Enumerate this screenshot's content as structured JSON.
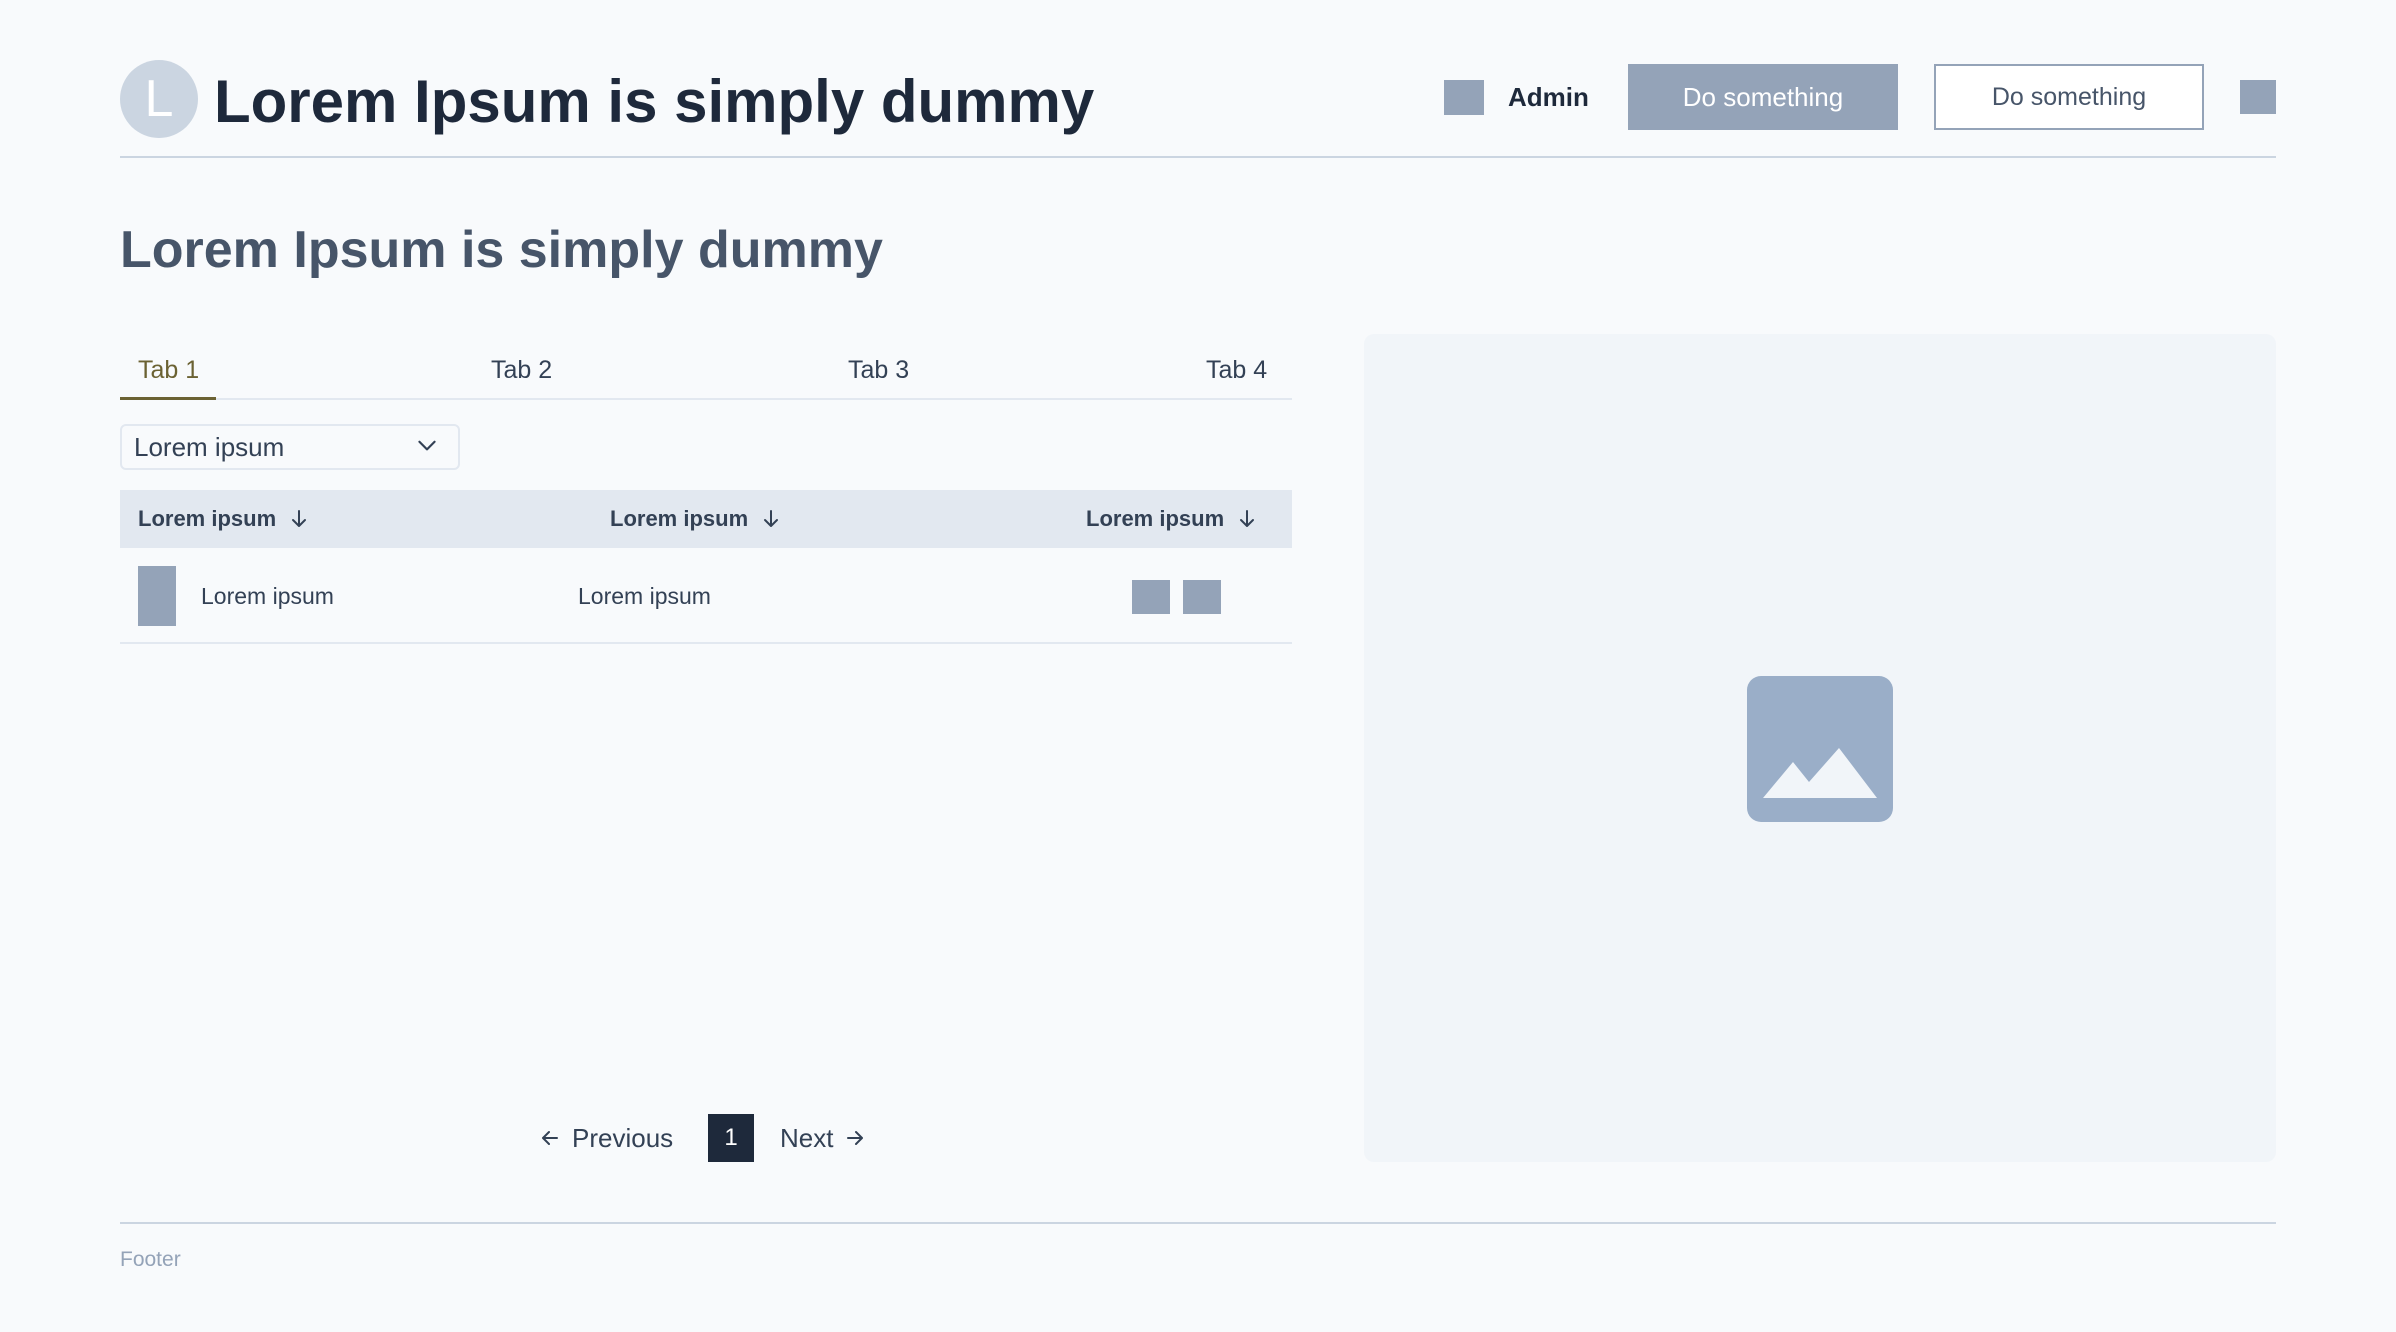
{
  "header": {
    "logo_letter": "L",
    "title": "Lorem Ipsum is simply dummy",
    "user_label": "Admin",
    "primary_button": "Do something",
    "secondary_button": "Do something"
  },
  "page": {
    "heading": "Lorem Ipsum is simply dummy"
  },
  "tabs": [
    {
      "label": "Tab 1",
      "active": true
    },
    {
      "label": "Tab 2",
      "active": false
    },
    {
      "label": "Tab 3",
      "active": false
    },
    {
      "label": "Tab 4",
      "active": false
    }
  ],
  "filter": {
    "selected": "Lorem ipsum"
  },
  "table": {
    "columns": [
      "Lorem ipsum",
      "Lorem ipsum",
      "Lorem ipsum"
    ],
    "rows": [
      {
        "col1": "Lorem ipsum",
        "col2": "Lorem ipsum"
      }
    ]
  },
  "pagination": {
    "previous_label": "Previous",
    "current_page": "1",
    "next_label": "Next"
  },
  "footer": {
    "text": "Footer"
  },
  "colors": {
    "background": "#f8fafc",
    "placeholder": "#94a3b8",
    "table_header": "#e2e8f0",
    "active_tab": "#6b6233",
    "dark": "#1e293b"
  },
  "icons": {
    "sort": "arrow-down-icon",
    "dropdown": "chevron-down-icon",
    "previous": "arrow-left-icon",
    "next": "arrow-right-icon",
    "media": "image-placeholder-icon"
  }
}
